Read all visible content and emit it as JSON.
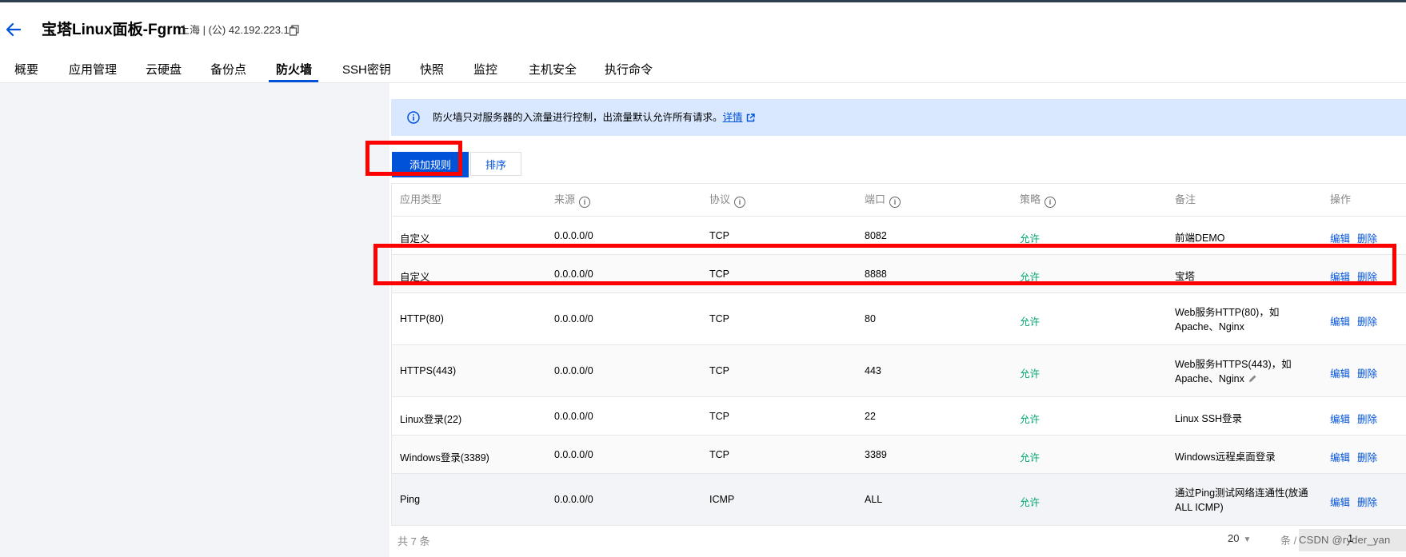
{
  "header": {
    "title": "宝塔Linux面板-Fgrm",
    "ip_info": "上海 | (公) 42.192.223.10"
  },
  "tabs": [
    {
      "label": "概要"
    },
    {
      "label": "应用管理"
    },
    {
      "label": "云硬盘"
    },
    {
      "label": "备份点"
    },
    {
      "label": "防火墙",
      "active": true
    },
    {
      "label": "SSH密钥"
    },
    {
      "label": "快照"
    },
    {
      "label": "监控"
    },
    {
      "label": "主机安全"
    },
    {
      "label": "执行命令"
    }
  ],
  "banner": {
    "message": "防火墙只对服务器的入流量进行控制，出流量默认允许所有请求。",
    "link": "详情"
  },
  "toolbar": {
    "add_label": "添加规则",
    "sort_label": "排序"
  },
  "table": {
    "headers": [
      "应用类型",
      "来源",
      "协议",
      "端口",
      "策略",
      "备注",
      "操作"
    ],
    "rows": [
      {
        "type": "自定义",
        "source": "0.0.0.0/0",
        "protocol": "TCP",
        "port": "8082",
        "policy": "允许",
        "note": "前端DEMO",
        "edit": "编辑",
        "delete": "删除"
      },
      {
        "type": "自定义",
        "source": "0.0.0.0/0",
        "protocol": "TCP",
        "port": "8888",
        "policy": "允许",
        "note": "宝塔",
        "edit": "编辑",
        "delete": "删除"
      },
      {
        "type": "HTTP(80)",
        "source": "0.0.0.0/0",
        "protocol": "TCP",
        "port": "80",
        "policy": "允许",
        "note": "Web服务HTTP(80)，如Apache、Nginx",
        "edit": "编辑",
        "delete": "删除"
      },
      {
        "type": "HTTPS(443)",
        "source": "0.0.0.0/0",
        "protocol": "TCP",
        "port": "443",
        "policy": "允许",
        "note": "Web服务HTTPS(443)，如Apache、Nginx",
        "edit": "编辑",
        "delete": "删除"
      },
      {
        "type": "Linux登录(22)",
        "source": "0.0.0.0/0",
        "protocol": "TCP",
        "port": "22",
        "policy": "允许",
        "note": "Linux SSH登录",
        "edit": "编辑",
        "delete": "删除"
      },
      {
        "type": "Windows登录(3389)",
        "source": "0.0.0.0/0",
        "protocol": "TCP",
        "port": "3389",
        "policy": "允许",
        "note": "Windows远程桌面登录",
        "edit": "编辑",
        "delete": "删除"
      },
      {
        "type": "Ping",
        "source": "0.0.0.0/0",
        "protocol": "ICMP",
        "port": "ALL",
        "policy": "允许",
        "note": "通过Ping测试网络连通性(放通ALL ICMP)",
        "edit": "编辑",
        "delete": "删除"
      }
    ]
  },
  "footer": {
    "total": "共 7 条",
    "page_size": "20",
    "page_unit": "条 / 页",
    "page_number": "1",
    "watermark": "CSDN @ryder_yan"
  },
  "colors": {
    "primary": "#0052d9",
    "allow": "#00a870",
    "highlight": "#ff0000",
    "banner_bg": "#d9e7ff"
  }
}
